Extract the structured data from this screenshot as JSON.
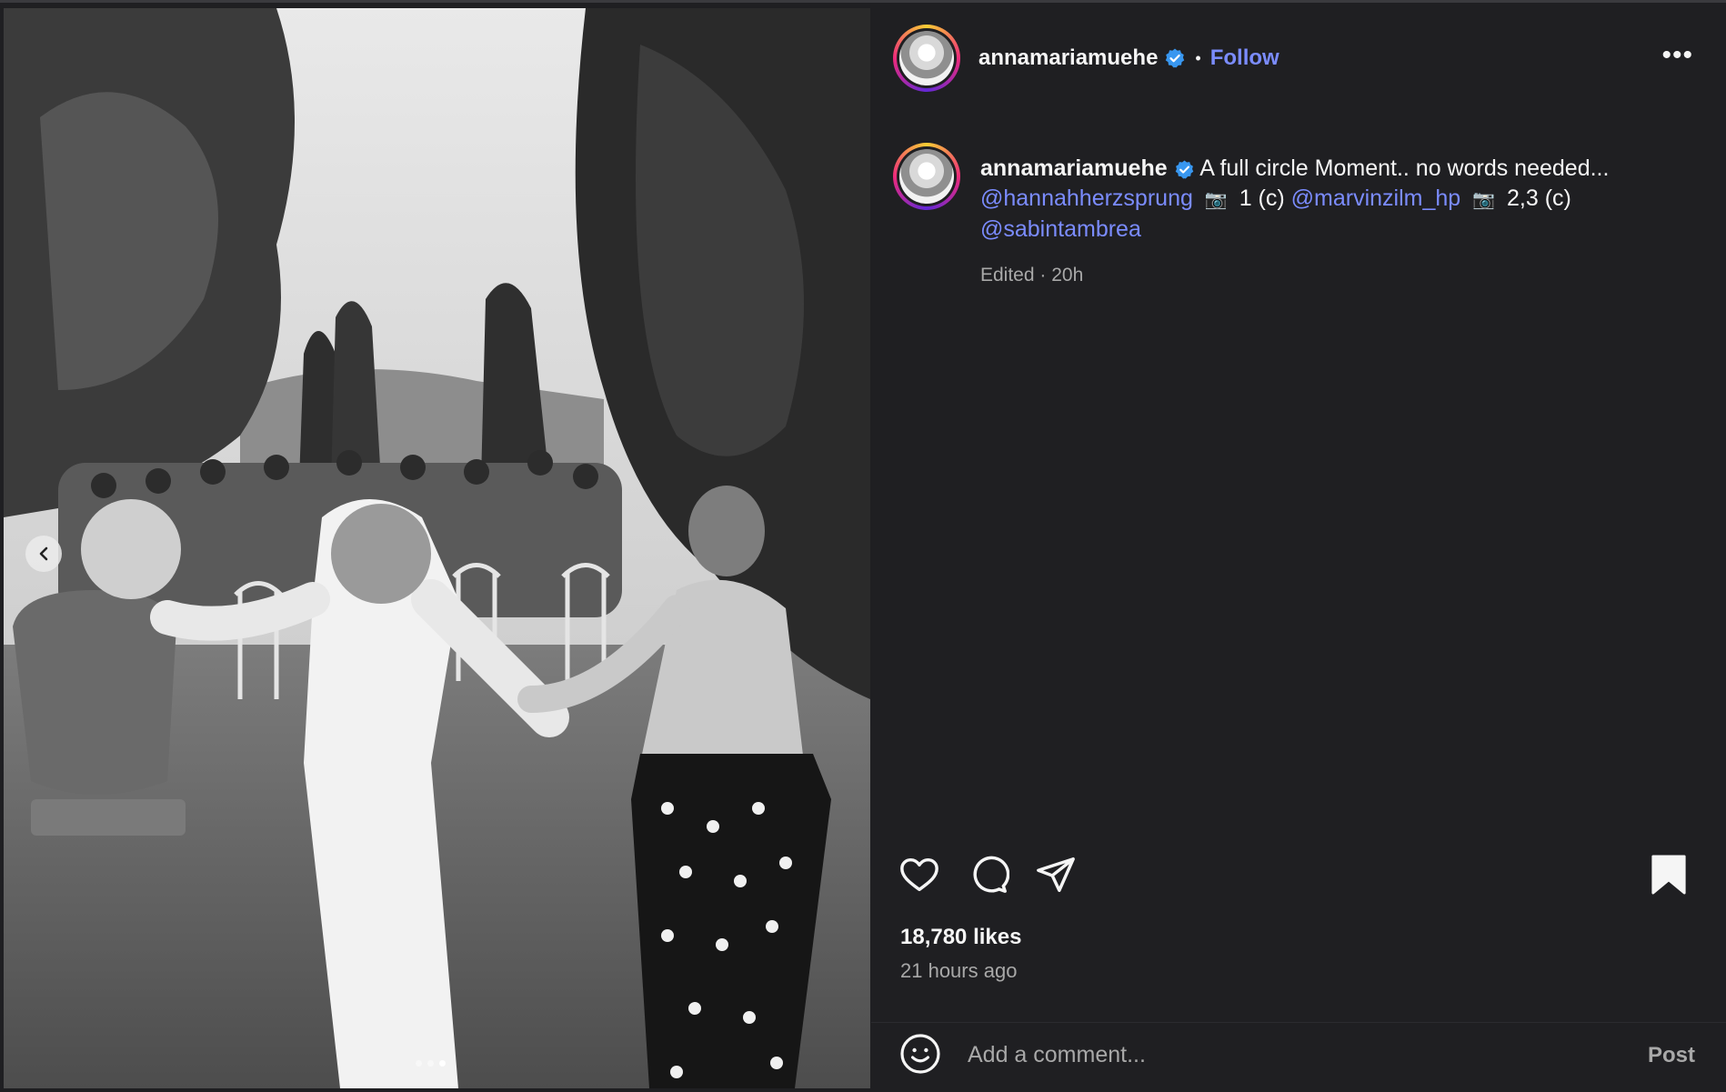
{
  "post": {
    "username": "annamariamuehe",
    "follow_label": "Follow",
    "separator": "•",
    "more_label": "•••",
    "caption": {
      "text": "A full circle Moment.. no words needed...",
      "mention1": "@hannahherzsprung",
      "camera1": "📷",
      "credit1": "1 (c)",
      "mention2": "@marvinzilm_hp",
      "camera2": "📷",
      "credit2": "2,3 (c)",
      "mention3": "@sabintambrea"
    },
    "meta": "Edited · 20h",
    "likes": "18,780 likes",
    "timestamp": "21 hours ago",
    "comment_placeholder": "Add a comment...",
    "post_label": "Post"
  },
  "carousel": {
    "current_slide": 3,
    "total_slides": 3
  },
  "colors": {
    "background": "#1f1f22",
    "link": "#7b8cff",
    "verified": "#3897f0",
    "muted": "#a8a8a8"
  },
  "icons": [
    "chevron-left-icon",
    "verified-icon",
    "more-icon",
    "heart-icon",
    "comment-icon",
    "share-icon",
    "bookmark-icon",
    "emoji-icon"
  ]
}
